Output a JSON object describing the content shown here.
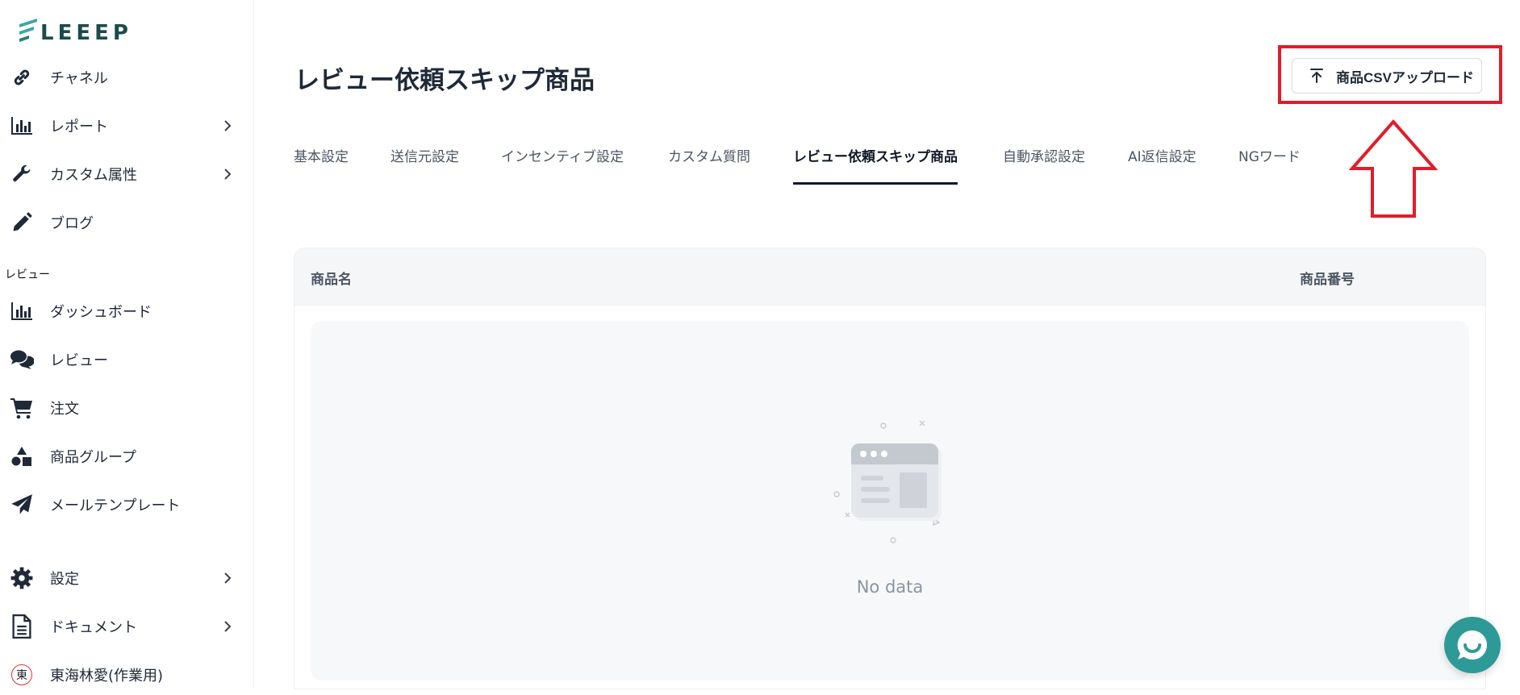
{
  "app": {
    "logo_text": "LEEEP"
  },
  "sidebar": {
    "items_top": [
      {
        "label": "チャネル",
        "icon": "link-icon",
        "has_chevron": false
      },
      {
        "label": "レポート",
        "icon": "bar-chart-icon",
        "has_chevron": true
      },
      {
        "label": "カスタム属性",
        "icon": "wrench-icon",
        "has_chevron": true
      },
      {
        "label": "ブログ",
        "icon": "pencil-icon",
        "has_chevron": false
      }
    ],
    "section_label": "レビュー",
    "items_review": [
      {
        "label": "ダッシュボード",
        "icon": "bar-chart-icon"
      },
      {
        "label": "レビュー",
        "icon": "chat-bubbles-icon"
      },
      {
        "label": "注文",
        "icon": "cart-icon"
      },
      {
        "label": "商品グループ",
        "icon": "shapes-icon"
      },
      {
        "label": "メールテンプレート",
        "icon": "paper-plane-icon"
      }
    ],
    "items_bottom": [
      {
        "label": "設定",
        "icon": "gear-icon",
        "has_chevron": true
      },
      {
        "label": "ドキュメント",
        "icon": "document-icon",
        "has_chevron": true
      },
      {
        "label": "東海林愛(作業用)",
        "icon": "avatar",
        "avatar_char": "東"
      }
    ]
  },
  "page": {
    "title": "レビュー依頼スキップ商品",
    "upload_button": "商品CSVアップロード",
    "tabs": [
      {
        "label": "基本設定"
      },
      {
        "label": "送信元設定"
      },
      {
        "label": "インセンティブ設定"
      },
      {
        "label": "カスタム質問"
      },
      {
        "label": "レビュー依頼スキップ商品",
        "active": true
      },
      {
        "label": "自動承認設定"
      },
      {
        "label": "AI返信設定"
      },
      {
        "label": "NGワード"
      }
    ],
    "table": {
      "columns": [
        "商品名",
        "商品番号"
      ],
      "empty_text": "No data"
    }
  },
  "colors": {
    "accent": "#2e9a97",
    "highlight": "#e11d2a",
    "text": "#1f2937",
    "muted": "#8a94a3"
  }
}
